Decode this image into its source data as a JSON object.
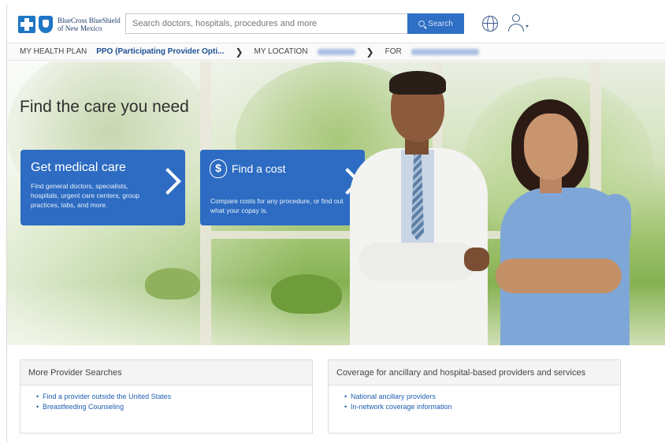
{
  "header": {
    "logo_line1": "BlueCross BlueShield",
    "logo_line2": "of New Mexico",
    "search_placeholder": "Search doctors, hospitals, procedures and more",
    "search_button_label": "Search"
  },
  "planbar": {
    "health_plan_label": "MY HEALTH PLAN",
    "health_plan_value": "PPO (Participating Provider Opti...",
    "location_label": "MY LOCATION",
    "for_label": "FOR",
    "separator": "❯"
  },
  "hero": {
    "title": "Find the care you need",
    "card_medical": {
      "title": "Get medical care",
      "description": "Find general doctors, specialists, hospitals, urgent care centers, group practices, labs, and more."
    },
    "card_cost": {
      "icon": "dollar-icon",
      "title": "Find a cost",
      "description": "Compare costs for any procedure, or find out what your copay is."
    }
  },
  "panels": {
    "more_searches": {
      "title": "More Provider Searches",
      "links": [
        "Find a provider outside the United States",
        "Breastfeeding Counseling"
      ]
    },
    "coverage": {
      "title": "Coverage for ancillary and hospital-based providers and services",
      "links": [
        "National ancillary providers",
        "In-network coverage information"
      ]
    }
  },
  "colors": {
    "brand_blue": "#2d6cc2",
    "link_blue": "#1f5fb0",
    "plan_value_blue": "#1d4f96"
  }
}
